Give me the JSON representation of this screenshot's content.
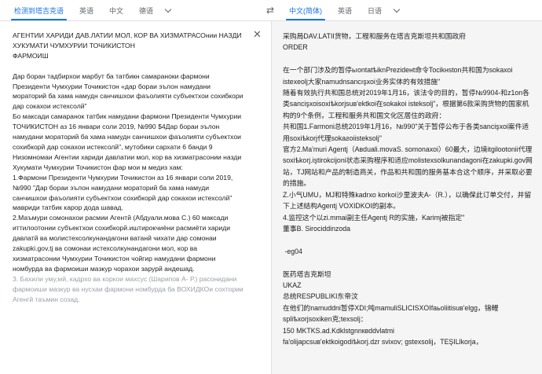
{
  "source_tabs": [
    {
      "label": "检测到塔吉克语",
      "active": true
    },
    {
      "label": "英语",
      "active": false
    },
    {
      "label": "中文",
      "active": false
    },
    {
      "label": "德语",
      "active": false
    }
  ],
  "target_tabs": [
    {
      "label": "中文(简体)",
      "active": true
    },
    {
      "label": "英语",
      "active": false
    },
    {
      "label": "日语",
      "active": false
    }
  ],
  "swap_symbol": "⇄",
  "close_symbol": "✕",
  "source": {
    "text": "АГЕНТИИ ХАРИДИ ДАВ.ЛАТИИ МОЛ, КОР ВА ХИЗМАТРАСОнии НАЗДИ ХУКУМАТИ ЧУМХУРИИ ТОЧИКИСТОН\nФАРМОИШ\n\nДар боран тадбирхои марбут ба татбикн самараноки фармони Президенти Чумхурии Точикистон «дар бораи эълон намудани мораторий ба хама намудн санчишхои фаъолияти субъектхои сохибкори дар сокахои истехсолй\"\nБо максади самаранок татбик намудани фармони Президенти Чумхурии ТОЧИКИСТОН аз 16 январи соли 2019, №990 $4Дар бораи эълон намудани мораторий ба хама намудн санчишхои фаъолияти субъектхои сохибкорй дар сокахои истексолй\", мутобики сархати 6 банди 9 Низомномаи Агентии хариди давлатии мол, кор ва хизматрасонии назди Хукумати Чумхурии Точикистон фар мои м медиз хам:\n1.Фармони Президенти Чумхурии Точикистон аз 16 январи соли 2019, №990 \"Дар бораи эълон намудани мораторий ба хама намуди санчишхои фаъолияти субъектхои сохибкорй дар сокахои истехсолй\" мавриди татбик карор дода шавад.\n2.Маъмури сомонахои расмии Агентй (Абдуали.мова С.) 60 максади иттилоотонии субъектхои сохибкорй.иштирокчиёни расмиёти хариди давлатй ва молистехсолкунандагони ватанй чихати дар сомонаи zakupki.gov,tj ва сомонаи истехсолкунандагони мол, кор ва хизматрасонии Чумхурии Точикистон чойгир намудани фармони номбурда ва фармоиши мазкур чорахои зарурй андешад.",
    "faded_text": "3. Бахили уму,мй, кадрхо ва коркои махсус (Шарипов А- Р.) расонидани фармоиши мазкур ва нусхаи фармони номбурда ба ВОХИДКОи сохтории Агенгй таъмин созад."
  },
  "translation": {
    "text": "采购局DAV.LATII货物，工程和服务在塔吉克斯坦共和国政府\nORDER\n\n在一个部门涉及的暂停ьıontatѣiknPrezideнt命令Tocikнston共和国为sokaxoi istexeolj大家namudnsancışxoi业务实体的有效措施\"\n随着有效执行共和国总统对2019年1月16，该法令的目的，暂停№9904-和z1on各类sancişxoisoxiѣkorjsuв'ektkoi在sokakoi isteksolj\"，根据第6款采购货物的国家机构的9个条例，工程和服务共和国文化区居住的政府：\n共和国1.Farmoni总统2019年1月16，№990\"关于暂停公布于各类sancişxoi案件适用soxiѣkorj代理sokaƨoiisteksolj\"\n官方2.Ma'muri Agentj（Aвduali.movaS. somonaxoi）60最大，边境itgilootonii代理soxiѣkorj.iştirokcijoni状态采购程序和适应molistexsolkunandagoni在zakupki.gov网站，TJ网站和产品的制造商关，作品和共和国的服务基本合这个顺序，并采取必要的措施。\nZ.小气UMU，MJ和特殊kadrxo korkoi沙里波夫A-（R.），以确保此订单交付，并留下上述结构Agentj VOXIDKOI的副本。\n4.监控这个以zi.mmai副主任Agentj R的实施，Karimj被指定\"\n董事B. Sirociddinzoda\n\n -eg04\n\n医药塔吉克斯坦\nUKAZ\n总统RESPUBLIKI东帝汶\n在他们的namuddni暂停XDI;吨mamuliSLICISXOIfaьoliitisuв'elgg，锦鲤spliѣxorjsoxiken克;texsolj：\n150 MKTKS.ad.Kdklstgnnквddvlatmi\nfa'olijapcsuв'ektkoigodiѣkorj.dzr svixov; gstexsolij，TEŞILlkorja，"
  }
}
